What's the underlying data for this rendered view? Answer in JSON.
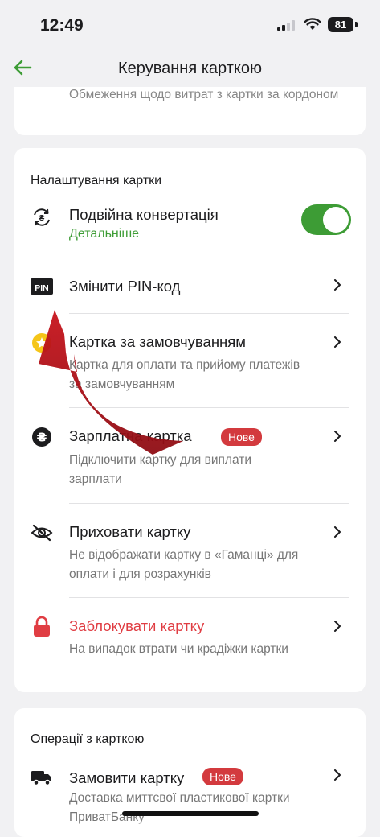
{
  "status_bar": {
    "time": "12:49",
    "battery": "81"
  },
  "nav": {
    "title": "Керування карткою"
  },
  "limits_card": {
    "text": "Обмеження щодо витрат з картки за кордоном"
  },
  "settings": {
    "title": "Налаштування картки",
    "items": [
      {
        "title": "Подвійна конвертація",
        "link": "Детальніше",
        "toggle_on": true,
        "icon": "currency-exchange-icon"
      },
      {
        "title": "Змінити PIN-код",
        "icon": "pin-icon",
        "icon_text": "PIN"
      },
      {
        "title": "Картка за замовчуванням",
        "sub": "Картка для оплати та прийому платежів за замовчуванням",
        "icon": "star-icon"
      },
      {
        "title": "Зарплатна картка",
        "badge": "Нове",
        "sub": "Підключити картку для виплати зарплати",
        "icon": "hryvnia-icon"
      },
      {
        "title": "Приховати картку",
        "sub": "Не відображати картку в «Гаманці» для оплати і для розрахунків",
        "icon": "eye-off-icon"
      },
      {
        "title": "Заблокувати картку",
        "sub": "На випадок втрати чи крадіжки картки",
        "icon": "lock-icon"
      }
    ]
  },
  "operations": {
    "title": "Операції з карткою",
    "items": [
      {
        "title": "Замовити картку",
        "badge": "Нове",
        "sub": "Доставка миттєвої пластикової картки ПриватБанку",
        "icon": "delivery-truck-icon"
      }
    ]
  },
  "colors": {
    "accent": "#3d9c35",
    "danger": "#e03d43",
    "badge": "#d33a3e",
    "annotation_arrow": "#b5121b"
  }
}
